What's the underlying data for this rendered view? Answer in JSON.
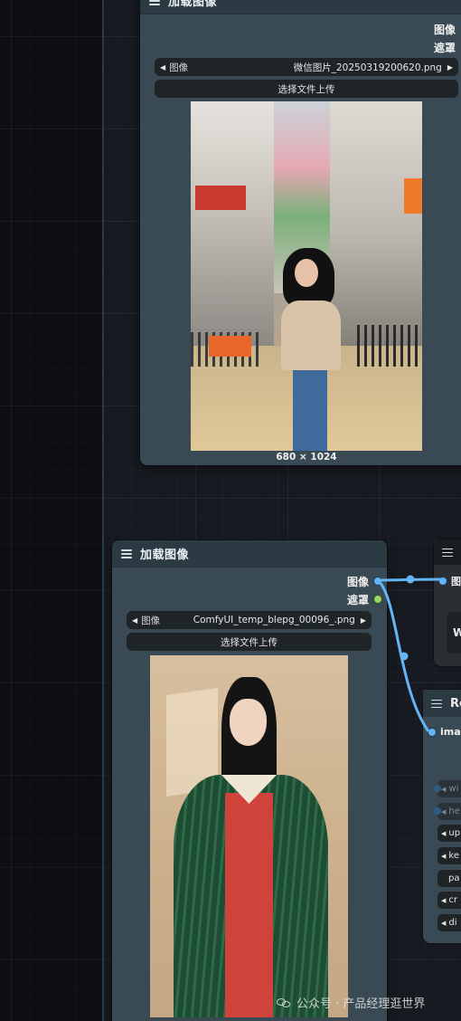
{
  "node_top": {
    "title": "加载图像",
    "outputs": [
      {
        "label": "图像",
        "type": "IMAGE"
      },
      {
        "label": "遮罩",
        "type": "MASK"
      }
    ],
    "image_combo": {
      "label": "图像",
      "value": "微信图片_20250319200620.png"
    },
    "upload_button": "选择文件上传",
    "dimensions": "680 × 1024"
  },
  "node_bottom": {
    "title": "加载图像",
    "outputs": [
      {
        "label": "图像",
        "type": "IMAGE"
      },
      {
        "label": "遮罩",
        "type": "MASK"
      }
    ],
    "image_combo": {
      "label": "图像",
      "value": "ComfyUI_temp_blepg_00096_.png"
    },
    "upload_button": "选择文件上传"
  },
  "node_right_top": {
    "input_label": "图",
    "inner_text": "W"
  },
  "node_right_bottom": {
    "title": "Re",
    "input_label": "imag",
    "widgets": [
      {
        "text": "wi",
        "state": "linked"
      },
      {
        "text": "he",
        "state": "linked"
      },
      {
        "text": "up",
        "state": "normal"
      },
      {
        "text": "ke",
        "state": "normal"
      },
      {
        "text": "pa",
        "state": "button"
      },
      {
        "text": "cr",
        "state": "normal"
      },
      {
        "text": "di",
        "state": "normal"
      }
    ]
  },
  "watermark": "公众号 · 产品经理逛世界",
  "colors": {
    "canvas": "#161a20",
    "node_body": "#3a4a54",
    "node_header": "#2c3a43",
    "image_link": "#64b5f6",
    "mask_slot": "#9ad66a"
  }
}
